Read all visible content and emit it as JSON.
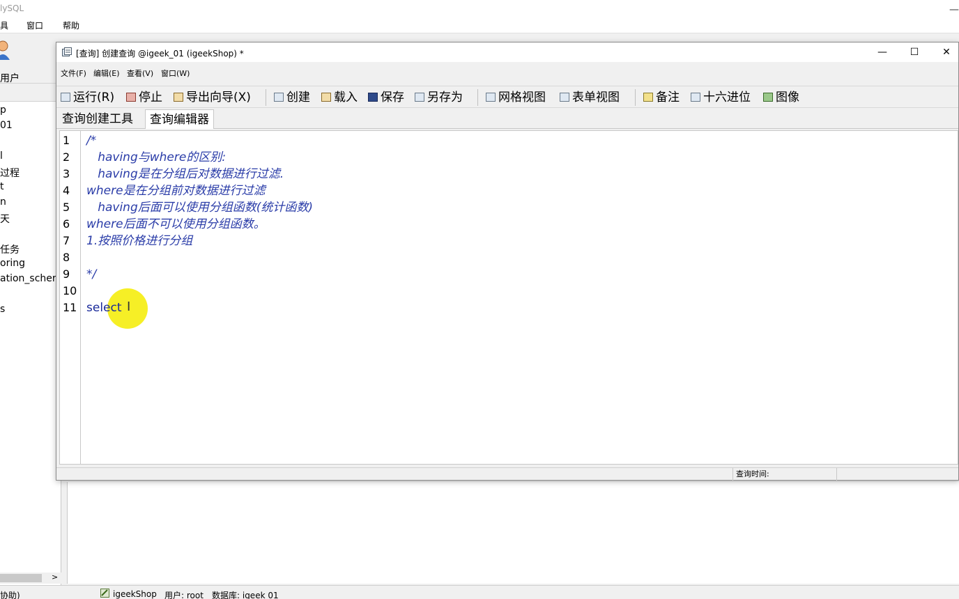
{
  "app": {
    "title": "lySQL",
    "menu": [
      "具",
      "窗口",
      "帮助"
    ],
    "user_label": "用户",
    "tree_items": [
      "p",
      "01",
      "l",
      "过程",
      "t",
      "n",
      "天",
      "任务",
      "oring",
      "ation_scher",
      "s"
    ],
    "status": {
      "left": "协助)",
      "connection": "igeekShop",
      "user": "用户: root",
      "database": "数据库: igeek 01"
    }
  },
  "query_window": {
    "title": "[查询] 创建查询 @igeek_01 (igeekShop) *",
    "controls": {
      "minimize": "—",
      "maximize": "☐",
      "close": "✕"
    },
    "menu": [
      "文件(F)",
      "编辑(E)",
      "查看(V)",
      "窗口(W)"
    ],
    "toolbar": {
      "run": "运行(R)",
      "stop": "停止",
      "export": "导出向导(X)",
      "create": "创建",
      "load": "载入",
      "save": "保存",
      "save_as": "另存为",
      "grid_view": "网格视图",
      "form_view": "表单视图",
      "memo": "备注",
      "hex": "十六进位",
      "image": "图像"
    },
    "tabs": [
      "查询创建工具",
      "查询编辑器"
    ],
    "active_tab": "查询编辑器",
    "editor": {
      "line_numbers": [
        "1",
        "2",
        "3",
        "4",
        "5",
        "6",
        "7",
        "8",
        "9",
        "10",
        "11"
      ],
      "lines": [
        "/*",
        "   having与where的区别:",
        "   having是在分组后对数据进行过滤.",
        "where是在分组前对数据进行过滤",
        "   having后面可以使用分组函数(统计函数)",
        "where后面不可以使用分组函数。",
        "1.按照价格进行分组",
        "",
        "*/",
        "",
        "select "
      ]
    },
    "status": {
      "query_time_label": "查询时间:"
    }
  },
  "icons": [
    "user-icon",
    "window-icon",
    "run-icon",
    "stop-icon",
    "export-icon",
    "create-icon",
    "load-icon",
    "save-icon",
    "save-as-icon",
    "grid-icon",
    "form-icon",
    "memo-icon",
    "hex-icon",
    "image-icon",
    "connection-icon"
  ],
  "colors": {
    "code_text": "#2a3ca8",
    "cursor_highlight": "#f5ee1a"
  }
}
